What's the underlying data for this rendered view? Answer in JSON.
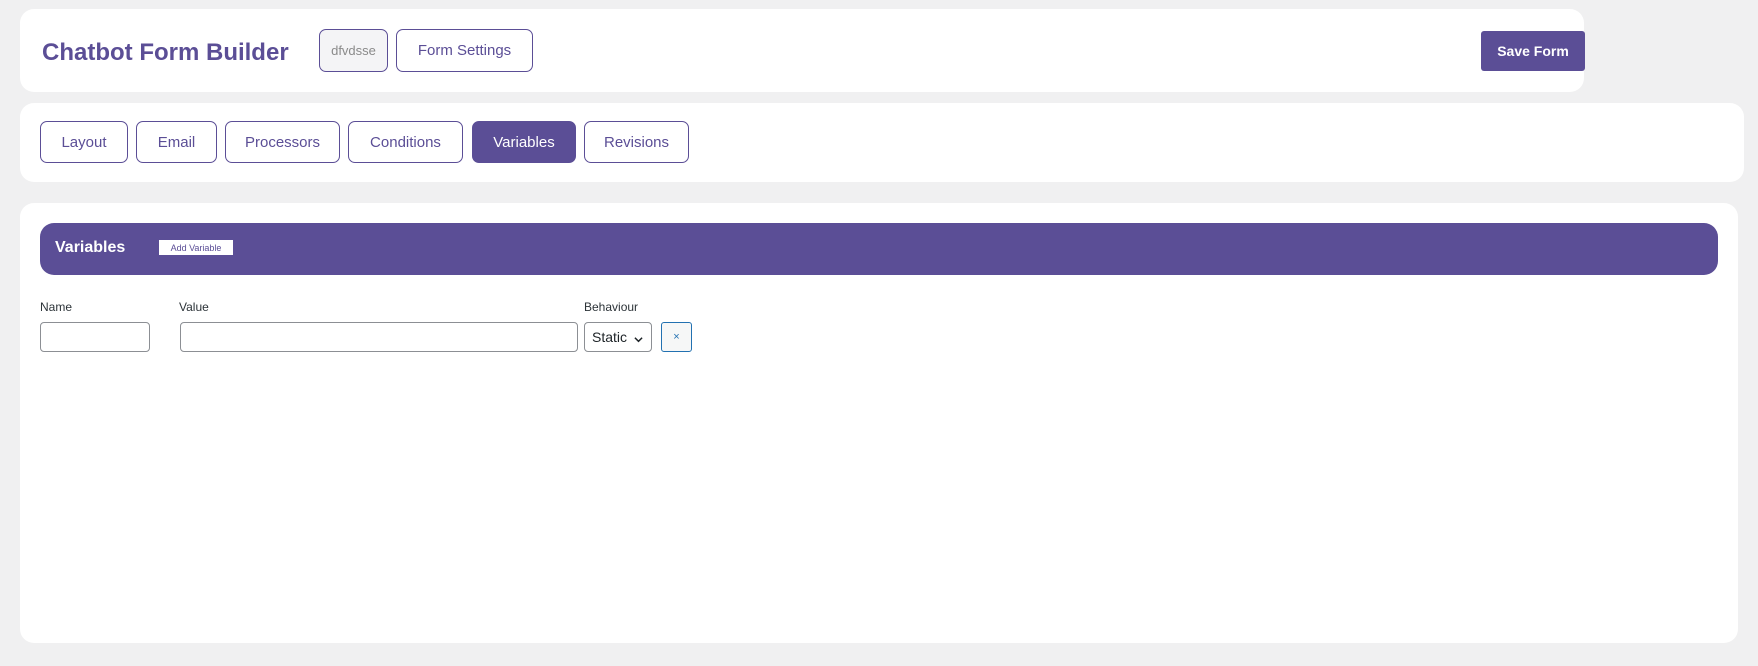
{
  "header": {
    "title": "Chatbot Form Builder",
    "form_id": "dfvdsse",
    "form_settings_label": "Form Settings",
    "save_label": "Save Form"
  },
  "tabs": [
    {
      "label": "Layout",
      "active": false
    },
    {
      "label": "Email",
      "active": false
    },
    {
      "label": "Processors",
      "active": false
    },
    {
      "label": "Conditions",
      "active": false
    },
    {
      "label": "Variables",
      "active": true
    },
    {
      "label": "Revisions",
      "active": false
    }
  ],
  "variables_panel": {
    "title": "Variables",
    "add_label": "Add Variable",
    "columns": {
      "name": "Name",
      "value": "Value",
      "behaviour": "Behaviour"
    },
    "rows": [
      {
        "name": "",
        "value": "",
        "behaviour": "Static",
        "remove_label": "×"
      }
    ]
  },
  "colors": {
    "accent": "#5b4e96",
    "background": "#f0f0f1",
    "remove_button": "#2271b1"
  }
}
